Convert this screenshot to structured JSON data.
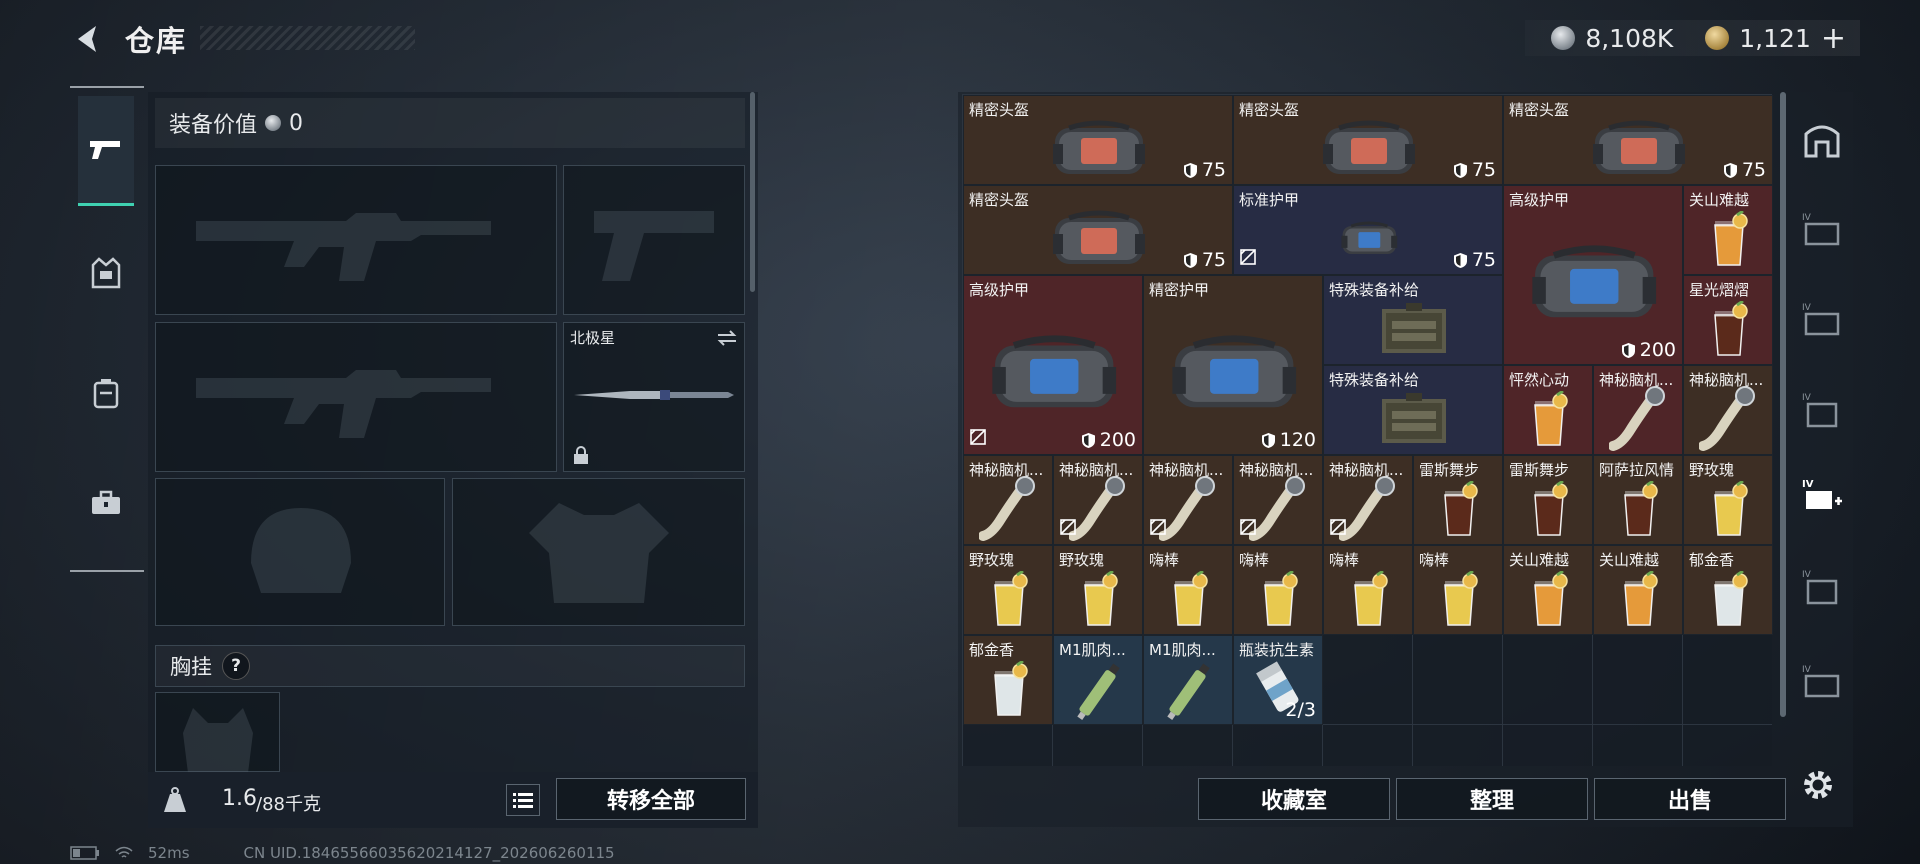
{
  "header": {
    "title": "仓库",
    "silver_amount": "8,108K",
    "gold_amount": "1,121",
    "gold_add": "+"
  },
  "left_tabs": [
    {
      "name": "weapon",
      "icon": "pistol-icon",
      "active": true
    },
    {
      "name": "armor",
      "icon": "vest-icon"
    },
    {
      "name": "backpack",
      "icon": "backpack-icon"
    },
    {
      "name": "case",
      "icon": "toolbox-icon"
    }
  ],
  "equipment": {
    "value_label": "装备价值",
    "value": "0",
    "melee_name": "北极星",
    "chest_label": "胸挂",
    "help": "?",
    "weight_current": "1.6",
    "weight_max": "/88千克",
    "transfer_all": "转移全部"
  },
  "inventory": {
    "items": [
      {
        "name": "精密头盔",
        "lvl": "75",
        "color": "brown",
        "img": "helmet"
      },
      {
        "name": "精密头盔",
        "lvl": "75",
        "color": "brown",
        "img": "helmet"
      },
      {
        "name": "精密头盔",
        "lvl": "75",
        "color": "brown",
        "img": "helmet"
      },
      {
        "name": "精密头盔",
        "lvl": "75",
        "color": "brown",
        "img": "helmet"
      },
      {
        "name": "标准护甲",
        "lvl": "75",
        "color": "navy",
        "img": "armor",
        "broken": true
      },
      {
        "name": "高级护甲",
        "lvl": "200",
        "color": "red",
        "img": "armor"
      },
      {
        "name": "关山难越",
        "color": "red",
        "img": "drink-orange"
      },
      {
        "name": "星光熠熠",
        "color": "red",
        "img": "drink-cola"
      },
      {
        "name": "高级护甲",
        "lvl": "200",
        "color": "red",
        "img": "armor",
        "broken": true
      },
      {
        "name": "精密护甲",
        "lvl": "120",
        "color": "brown",
        "img": "armor"
      },
      {
        "name": "特殊装备补给",
        "color": "navy",
        "img": "crate"
      },
      {
        "name": "特殊装备补给",
        "color": "navy",
        "img": "crate"
      },
      {
        "name": "怦然心动",
        "color": "red",
        "img": "drink-orange"
      },
      {
        "name": "神秘脑机...",
        "color": "red",
        "img": "scroll"
      },
      {
        "name": "神秘脑机...",
        "color": "brown",
        "img": "scroll"
      },
      {
        "name": "神秘脑机...",
        "color": "brown",
        "img": "scroll"
      },
      {
        "name": "神秘脑机...",
        "color": "brown",
        "img": "scroll",
        "broken": true
      },
      {
        "name": "神秘脑机...",
        "color": "brown",
        "img": "scroll",
        "broken": true
      },
      {
        "name": "神秘脑机...",
        "color": "brown",
        "img": "scroll",
        "broken": true
      },
      {
        "name": "神秘脑机...",
        "color": "brown",
        "img": "scroll",
        "broken": true
      },
      {
        "name": "雷斯舞步",
        "color": "brown",
        "img": "drink-cola"
      },
      {
        "name": "雷斯舞步",
        "color": "brown",
        "img": "drink-cola"
      },
      {
        "name": "阿萨拉风情",
        "color": "brown",
        "img": "drink-cola"
      },
      {
        "name": "野玫瑰",
        "color": "brown",
        "img": "drink-yellow"
      },
      {
        "name": "野玫瑰",
        "color": "brown",
        "img": "drink-yellow"
      },
      {
        "name": "野玫瑰",
        "color": "brown",
        "img": "drink-yellow"
      },
      {
        "name": "嗨棒",
        "color": "brown",
        "img": "drink-yellow"
      },
      {
        "name": "嗨棒",
        "color": "brown",
        "img": "drink-yellow"
      },
      {
        "name": "嗨棒",
        "color": "brown",
        "img": "drink-yellow"
      },
      {
        "name": "嗨棒",
        "color": "brown",
        "img": "drink-yellow"
      },
      {
        "name": "关山难越",
        "color": "brown",
        "img": "drink-orange"
      },
      {
        "name": "关山难越",
        "color": "brown",
        "img": "drink-orange"
      },
      {
        "name": "郁金香",
        "color": "brown",
        "img": "drink-clear"
      },
      {
        "name": "郁金香",
        "color": "brown",
        "img": "drink-clear"
      },
      {
        "name": "M1肌肉...",
        "color": "blue",
        "img": "syringe"
      },
      {
        "name": "M1肌肉...",
        "color": "blue",
        "img": "syringe"
      },
      {
        "name": "瓶装抗生素",
        "color": "blue",
        "img": "bottle",
        "count": "2/3"
      }
    ],
    "buttons": {
      "collection": "收藏室",
      "organize": "整理",
      "sell": "出售"
    }
  },
  "status": {
    "ping": "52ms",
    "uid": "CN UID.18465566035620214127_202606260115"
  },
  "colors": {
    "accent": "#3fd1b1",
    "brown": "#3d2e24",
    "red": "#4f2528",
    "navy": "#272c44",
    "blue": "#25384a"
  }
}
